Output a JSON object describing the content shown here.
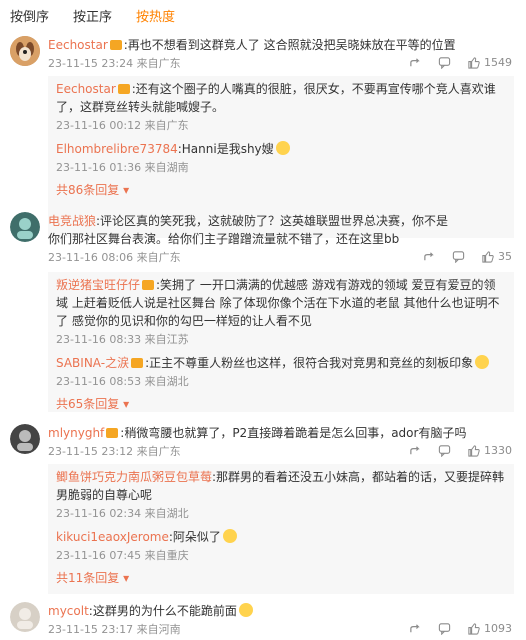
{
  "sort": {
    "tabs": [
      {
        "label": "按倒序"
      },
      {
        "label": "按正序"
      },
      {
        "label": "按热度",
        "active": true
      }
    ]
  },
  "colors": {
    "accent": "#ff8200",
    "name": "#eb7350",
    "meta": "#939393"
  },
  "comments": [
    {
      "user": "Eechostar",
      "text": ":再也不想看到这群竞人了 这合照就没把吴晓妹放在平等的位置",
      "meta": "23-11-15 23:24 来自广东",
      "likes": "1549",
      "replies": [
        {
          "user": "Eechostar",
          "text": ":还有这个圈子的人嘴真的很脏，很厌女，不要再宣传哪个竞人喜欢谁了，这群竞丝转头就能喊嫂子。",
          "meta": "23-11-16 00:12 来自广东"
        },
        {
          "user": "Elhombrelibre73784",
          "text": ":Hanni是我shy嫂",
          "meta": "23-11-16 01:36 来自湖南"
        }
      ],
      "more": "共86条回复"
    },
    {
      "user": "电竞战狼",
      "text": ":评论区真的笑死我，这就破防了？这英雄联盟世界总决赛，你不是你们那社区舞台表演。给你们主子蹭蹭流量就不错了，还在这里bb",
      "meta": "23-11-16 08:06 来自广东",
      "likes": "35",
      "replies": [
        {
          "user": "叛逆猪宝旺仔仔",
          "text": ":笑拥了 一开口满满的优越感 游戏有游戏的领域 爱豆有爱豆的领域 上赶着贬低人说是社区舞台 除了体现你像个活在下水道的老鼠 其他什么也证明不了 感觉你的见识和你的勾巴一样短的让人看不见",
          "meta": "23-11-16 08:33 来自江苏"
        },
        {
          "user": "SABINA-之涙",
          "text": ":正主不尊重人粉丝也这样，很符合我对竞男和竞丝的刻板印象",
          "meta": "23-11-16 08:53 来自湖北"
        }
      ],
      "more": "共65条回复"
    },
    {
      "user": "mlynyghf",
      "text": ":稍微弯腰也就算了，P2直接蹲着跪着是怎么回事，ador有脑子吗",
      "meta": "23-11-15 23:12 来自广东",
      "likes": "1330",
      "replies": [
        {
          "user": "鲫鱼饼巧克力南瓜粥豆包草莓",
          "text": ":那群男的看着还没五小妹高，都站着的话，又要提碎韩男脆弱的自尊心呢",
          "meta": "23-11-16 02:34 来自湖北"
        },
        {
          "user": "kikuci1eaoxJerome",
          "text": ":阿朵似了",
          "meta": "23-11-16 07:45 来自重庆"
        }
      ],
      "more": "共11条回复"
    },
    {
      "user": "mycolt",
      "text": ":这群男的为什么不能跪前面",
      "meta": "23-11-15 23:17 来自河南",
      "likes": "1093",
      "replies": []
    }
  ]
}
